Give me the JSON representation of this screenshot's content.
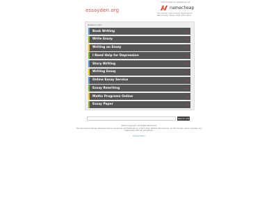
{
  "header": {
    "domain": "essayden.org",
    "parked_note": "This domain is registered at",
    "registrar_name": "namecheap",
    "registrar_description": "This domain was recently registered at Namecheap. Please check back later!",
    "colors": {
      "domain": "#d9534f",
      "namecheap_mark": "#de3723"
    }
  },
  "related": {
    "title": "Related Links",
    "arrow_icon": "chevron-right-icon",
    "items": [
      {
        "label": "Book Writing"
      },
      {
        "label": "Write Essay"
      },
      {
        "label": "Writing an Essay"
      },
      {
        "label": "I Need Help for Depression"
      },
      {
        "label": "Story Writing"
      },
      {
        "label": "Writing Essay"
      },
      {
        "label": "Online Essay Service"
      },
      {
        "label": "Essay Rewriting"
      },
      {
        "label": "Maths Programs Online"
      },
      {
        "label": "Essay Paper"
      }
    ]
  },
  "search": {
    "placeholder": "",
    "button_label": "Search Ads"
  },
  "footer": {
    "copyright": "2024 Copyright. All Rights Reserved.",
    "disclaimer": "The Sponsored Listings displayed above are served automatically by a third party. Neither Parkingcrew nor the domain owner maintain any relationship with the advertisers.",
    "privacy_link": "Privacy Policy"
  }
}
